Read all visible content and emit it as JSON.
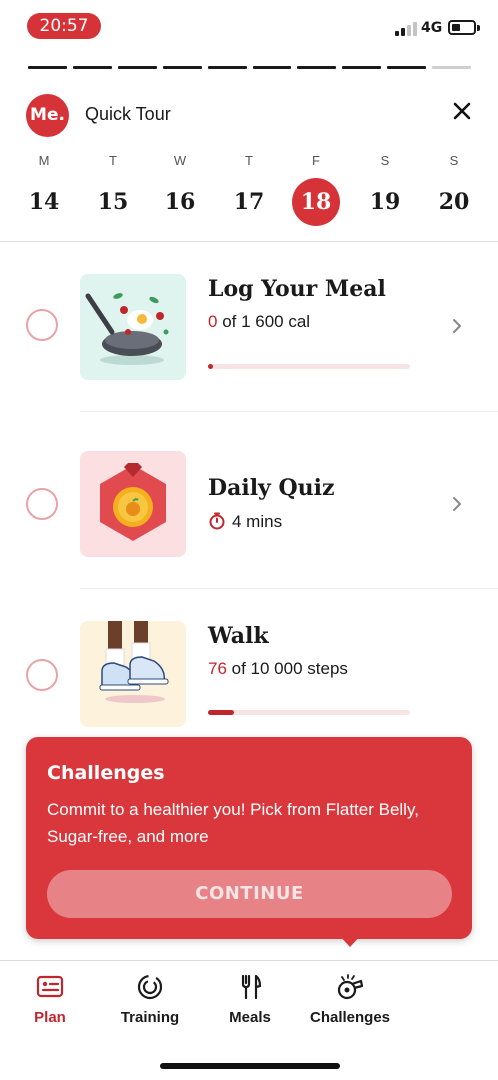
{
  "status_bar": {
    "time": "20:57",
    "network": "4G"
  },
  "tour_progress": {
    "total_steps": 10,
    "completed_steps": 9
  },
  "header": {
    "logo_text": "Me.",
    "title": "Quick Tour"
  },
  "week": [
    {
      "dow": "M",
      "num": "14",
      "selected": false
    },
    {
      "dow": "T",
      "num": "15",
      "selected": false
    },
    {
      "dow": "W",
      "num": "16",
      "selected": false
    },
    {
      "dow": "T",
      "num": "17",
      "selected": false
    },
    {
      "dow": "F",
      "num": "18",
      "selected": true
    },
    {
      "dow": "S",
      "num": "19",
      "selected": false
    },
    {
      "dow": "S",
      "num": "20",
      "selected": false
    }
  ],
  "tasks": [
    {
      "title": "Log Your Meal",
      "sub_value": "0",
      "sub_rest": " of 1 600 cal",
      "progress": 0.02,
      "thumb_bg": "#dff3ef",
      "icon": "pan-icon"
    },
    {
      "title": "Daily Quiz",
      "sub_value": "",
      "sub_rest": "4 mins",
      "thumb_bg": "#fbdfe1",
      "icon": "medal-icon"
    },
    {
      "title": "Walk",
      "sub_value": "76",
      "sub_rest": " of 10 000 steps",
      "progress": 0.13,
      "thumb_bg": "#fdf3dc",
      "icon": "sneakers-icon"
    }
  ],
  "popover": {
    "title": "Challenges",
    "body": "Commit to a healthier you! Pick from Flatter Belly, Sugar-free, and more",
    "button": "CONTINUE"
  },
  "nav": [
    {
      "label": "Plan",
      "icon": "plan-icon",
      "active": true
    },
    {
      "label": "Training",
      "icon": "training-icon",
      "active": false
    },
    {
      "label": "Meals",
      "icon": "meals-icon",
      "active": false
    },
    {
      "label": "Challenges",
      "icon": "challenges-icon",
      "active": false
    }
  ],
  "colors": {
    "brand_red": "#d63338",
    "accent_red": "#c0272d"
  }
}
